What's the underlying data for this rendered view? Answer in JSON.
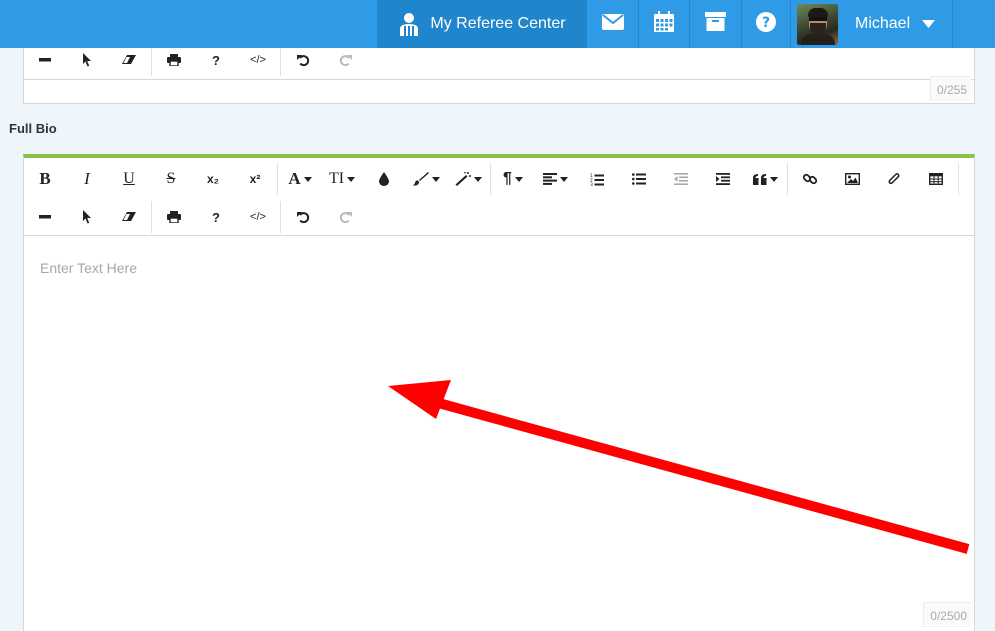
{
  "nav": {
    "referee_center": "My Referee Center",
    "user_name": "Michael",
    "icons": [
      "mail-icon",
      "calendar-icon",
      "archive-icon",
      "help-icon"
    ]
  },
  "short_bio": {
    "counter": "0/255"
  },
  "full_bio": {
    "label": "Full Bio",
    "placeholder": "Enter Text Here",
    "counter": "0/2500"
  },
  "toolbar": {
    "bold": "B",
    "italic": "I",
    "underline": "U",
    "strike": "S",
    "subscript": "x₂",
    "superscript": "x²",
    "font_family": "A",
    "font_size": "TI",
    "paragraph": "¶",
    "help": "?",
    "code": "</>"
  },
  "colors": {
    "nav_bg": "#2f9be6",
    "nav_active": "#1f86cd",
    "accent_green": "#8bc34a",
    "arrow_red": "#ff0000"
  }
}
